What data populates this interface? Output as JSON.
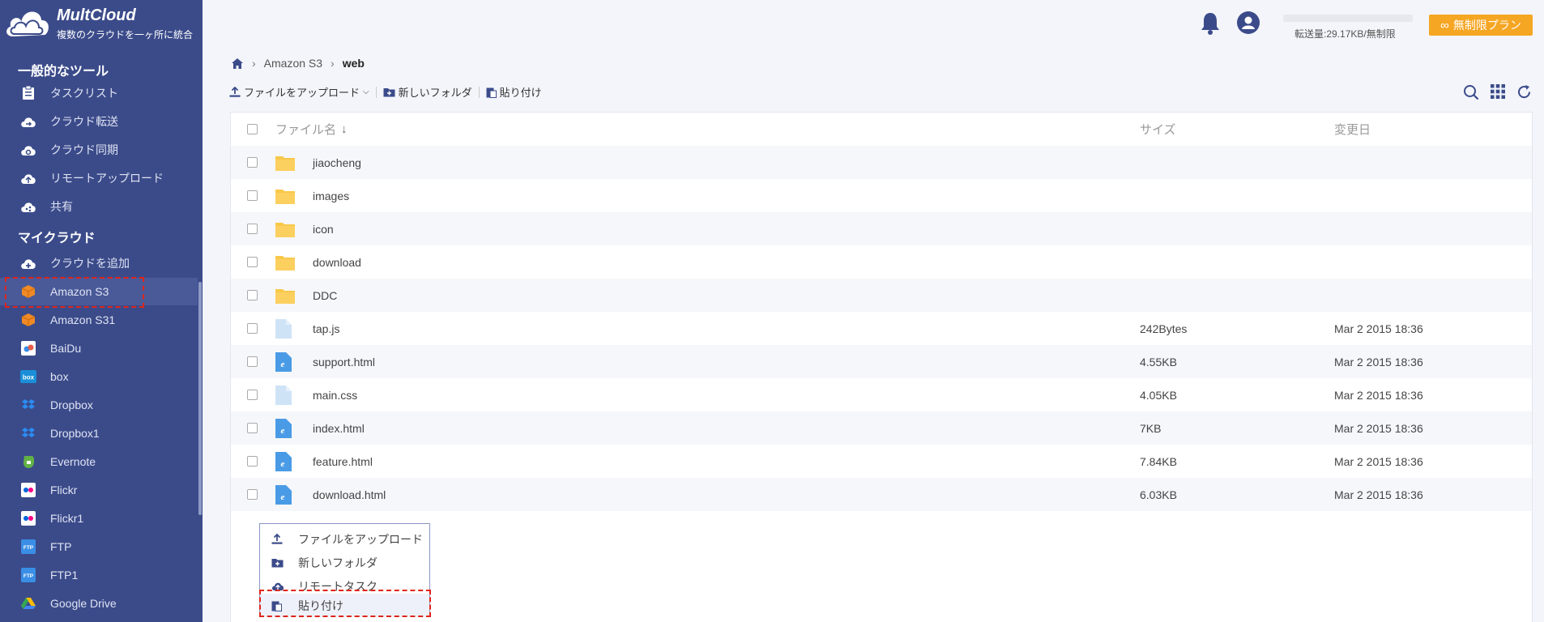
{
  "app": {
    "name": "MultCloud",
    "tagline": "複数のクラウドを一ヶ所に統合"
  },
  "sidebar": {
    "general_title": "一般的なツール",
    "general_items": [
      {
        "label": "タスクリスト",
        "icon": "task-list-icon"
      },
      {
        "label": "クラウド転送",
        "icon": "cloud-transfer-icon"
      },
      {
        "label": "クラウド同期",
        "icon": "cloud-sync-icon"
      },
      {
        "label": "リモートアップロード",
        "icon": "remote-upload-icon"
      },
      {
        "label": "共有",
        "icon": "share-icon"
      }
    ],
    "mycloud_title": "マイクラウド",
    "add_cloud": "クラウドを追加",
    "clouds": [
      {
        "label": "Amazon S3",
        "icon": "amazon-s3-icon",
        "color": "#f08a24",
        "active": true
      },
      {
        "label": "Amazon S31",
        "icon": "amazon-s3-icon",
        "color": "#f08a24"
      },
      {
        "label": "BaiDu",
        "icon": "baidu-icon",
        "color": "#3a8ee6"
      },
      {
        "label": "box",
        "icon": "box-icon",
        "color": "#1a8fd8"
      },
      {
        "label": "Dropbox",
        "icon": "dropbox-icon",
        "color": "#2b8cf2"
      },
      {
        "label": "Dropbox1",
        "icon": "dropbox-icon",
        "color": "#2b8cf2"
      },
      {
        "label": "Evernote",
        "icon": "evernote-icon",
        "color": "#62b246"
      },
      {
        "label": "Flickr",
        "icon": "flickr-icon",
        "color": "#ff0084"
      },
      {
        "label": "Flickr1",
        "icon": "flickr-icon",
        "color": "#ff0084"
      },
      {
        "label": "FTP",
        "icon": "ftp-icon",
        "color": "#3a8ee6"
      },
      {
        "label": "FTP1",
        "icon": "ftp-icon",
        "color": "#3a8ee6"
      },
      {
        "label": "Google Drive",
        "icon": "google-drive-icon",
        "color": "#34a853"
      }
    ]
  },
  "header": {
    "usage_text": "転送量:29.17KB/無制限",
    "plan_button": "無制限プラン"
  },
  "breadcrumb": {
    "items": [
      "Amazon S3",
      "web"
    ]
  },
  "toolbar": {
    "upload": "ファイルをアップロード",
    "new_folder": "新しいフォルダ",
    "paste": "貼り付け"
  },
  "table": {
    "col_name": "ファイル名",
    "col_size": "サイズ",
    "col_date": "変更日",
    "rows": [
      {
        "name": "jiaocheng",
        "type": "folder",
        "size": "",
        "date": ""
      },
      {
        "name": "images",
        "type": "folder",
        "size": "",
        "date": ""
      },
      {
        "name": "icon",
        "type": "folder",
        "size": "",
        "date": ""
      },
      {
        "name": "download",
        "type": "folder",
        "size": "",
        "date": ""
      },
      {
        "name": "DDC",
        "type": "folder",
        "size": "",
        "date": ""
      },
      {
        "name": "tap.js",
        "type": "file",
        "size": "242Bytes",
        "date": "Mar 2 2015 18:36"
      },
      {
        "name": "support.html",
        "type": "html",
        "size": "4.55KB",
        "date": "Mar 2 2015 18:36"
      },
      {
        "name": "main.css",
        "type": "file",
        "size": "4.05KB",
        "date": "Mar 2 2015 18:36"
      },
      {
        "name": "index.html",
        "type": "html",
        "size": "7KB",
        "date": "Mar 2 2015 18:36"
      },
      {
        "name": "feature.html",
        "type": "html",
        "size": "7.84KB",
        "date": "Mar 2 2015 18:36"
      },
      {
        "name": "download.html",
        "type": "html",
        "size": "6.03KB",
        "date": "Mar 2 2015 18:36"
      }
    ]
  },
  "context_menu": {
    "items": [
      {
        "label": "ファイルをアップロード",
        "icon": "upload-icon"
      },
      {
        "label": "新しいフォルダ",
        "icon": "new-folder-icon"
      },
      {
        "label": "リモートタスク",
        "icon": "remote-task-icon"
      },
      {
        "label": "貼り付け",
        "icon": "paste-icon",
        "active": true
      }
    ]
  },
  "colors": {
    "sidebar_bg": "#3b4b8a",
    "accent": "#f5a623",
    "highlight_border": "#e0241b",
    "folder": "#f9c84a"
  }
}
